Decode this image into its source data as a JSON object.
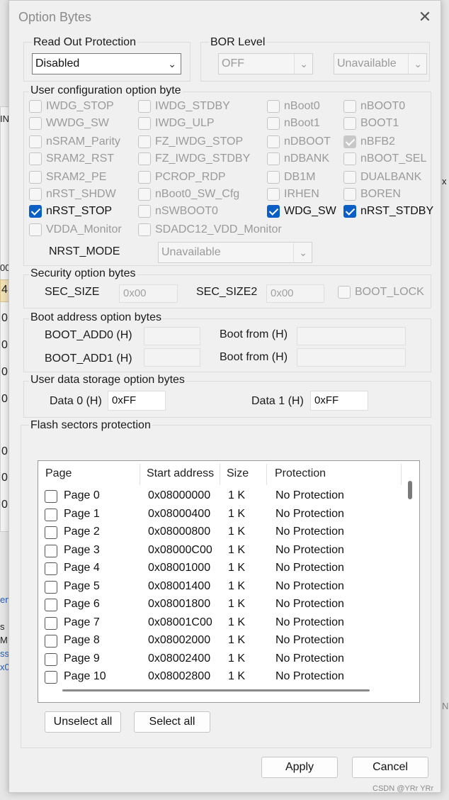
{
  "background": {
    "edge_texts": [
      "IN",
      "00",
      "0",
      "0",
      "0",
      "0",
      "0",
      "0",
      "0",
      "en",
      "s",
      "M",
      "ss",
      "x0",
      "x",
      "N"
    ],
    "accent_row": "4"
  },
  "dialog": {
    "title": "Option Bytes",
    "close_label": "✕"
  },
  "read_out": {
    "label": "Read Out Protection",
    "value": "Disabled"
  },
  "bor": {
    "label": "BOR Level",
    "value": "OFF",
    "value2": "Unavailable"
  },
  "user_config": {
    "label": "User configuration option byte",
    "checkboxes": [
      {
        "label": "IWDG_STOP",
        "checked": false
      },
      {
        "label": "IWDG_STDBY",
        "checked": false
      },
      {
        "label": "nBoot0",
        "checked": false
      },
      {
        "label": "nBOOT0",
        "checked": false
      },
      {
        "label": "WWDG_SW",
        "checked": false
      },
      {
        "label": "IWDG_ULP",
        "checked": false
      },
      {
        "label": "nBoot1",
        "checked": false
      },
      {
        "label": "BOOT1",
        "checked": false
      },
      {
        "label": "nSRAM_Parity",
        "checked": false
      },
      {
        "label": "FZ_IWDG_STOP",
        "checked": false
      },
      {
        "label": "nDBOOT",
        "checked": false
      },
      {
        "label": "nBFB2",
        "checked": true,
        "disabled": true
      },
      {
        "label": "SRAM2_RST",
        "checked": false
      },
      {
        "label": "FZ_IWDG_STDBY",
        "checked": false
      },
      {
        "label": "nDBANK",
        "checked": false
      },
      {
        "label": "nBOOT_SEL",
        "checked": false
      },
      {
        "label": "SRAM2_PE",
        "checked": false
      },
      {
        "label": "PCROP_RDP",
        "checked": false
      },
      {
        "label": "DB1M",
        "checked": false
      },
      {
        "label": "DUALBANK",
        "checked": false
      },
      {
        "label": "nRST_SHDW",
        "checked": false
      },
      {
        "label": "nBoot0_SW_Cfg",
        "checked": false
      },
      {
        "label": "IRHEN",
        "checked": false
      },
      {
        "label": "BOREN",
        "checked": false
      },
      {
        "label": "nRST_STOP",
        "checked": true
      },
      {
        "label": "nSWBOOT0",
        "checked": false
      },
      {
        "label": "WDG_SW",
        "checked": true
      },
      {
        "label": "nRST_STDBY",
        "checked": true
      },
      {
        "label": "VDDA_Monitor",
        "checked": false
      },
      {
        "label": "SDADC12_VDD_Monitor",
        "checked": false
      }
    ],
    "nrst_mode_label": "NRST_MODE",
    "nrst_mode_value": "Unavailable"
  },
  "security": {
    "label": "Security option bytes",
    "sec_size_label": "SEC_SIZE",
    "sec_size_value": "0x00",
    "sec_size2_label": "SEC_SIZE2",
    "sec_size2_value": "0x00",
    "boot_lock_label": "BOOT_LOCK"
  },
  "boot_address": {
    "label": "Boot address option bytes",
    "add0_label": "BOOT_ADD0 (H)",
    "add1_label": "BOOT_ADD1 (H)",
    "boot_from_label": "Boot from (H)"
  },
  "user_data": {
    "label": "User data storage option bytes",
    "data0_label": "Data 0 (H)",
    "data0_value": "0xFF",
    "data1_label": "Data 1 (H)",
    "data1_value": "0xFF"
  },
  "flash": {
    "label": "Flash sectors protection",
    "columns": [
      "Page",
      "Start address",
      "Size",
      "Protection"
    ],
    "rows": [
      {
        "page": "Page 0",
        "address": "0x08000000",
        "size": "1 K",
        "protection": "No Protection"
      },
      {
        "page": "Page 1",
        "address": "0x08000400",
        "size": "1 K",
        "protection": "No Protection"
      },
      {
        "page": "Page 2",
        "address": "0x08000800",
        "size": "1 K",
        "protection": "No Protection"
      },
      {
        "page": "Page 3",
        "address": "0x08000C00",
        "size": "1 K",
        "protection": "No Protection"
      },
      {
        "page": "Page 4",
        "address": "0x08001000",
        "size": "1 K",
        "protection": "No Protection"
      },
      {
        "page": "Page 5",
        "address": "0x08001400",
        "size": "1 K",
        "protection": "No Protection"
      },
      {
        "page": "Page 6",
        "address": "0x08001800",
        "size": "1 K",
        "protection": "No Protection"
      },
      {
        "page": "Page 7",
        "address": "0x08001C00",
        "size": "1 K",
        "protection": "No Protection"
      },
      {
        "page": "Page 8",
        "address": "0x08002000",
        "size": "1 K",
        "protection": "No Protection"
      },
      {
        "page": "Page 9",
        "address": "0x08002400",
        "size": "1 K",
        "protection": "No Protection"
      },
      {
        "page": "Page 10",
        "address": "0x08002800",
        "size": "1 K",
        "protection": "No Protection"
      }
    ],
    "unselect_all": "Unselect all",
    "select_all": "Select all"
  },
  "footer": {
    "apply": "Apply",
    "cancel": "Cancel"
  },
  "watermark": "CSDN @YRr YRr",
  "colors": {
    "accent": "#0a5fc4",
    "dialog_bg": "#f0f0f0",
    "highlight_row": "#f3e2b8"
  }
}
